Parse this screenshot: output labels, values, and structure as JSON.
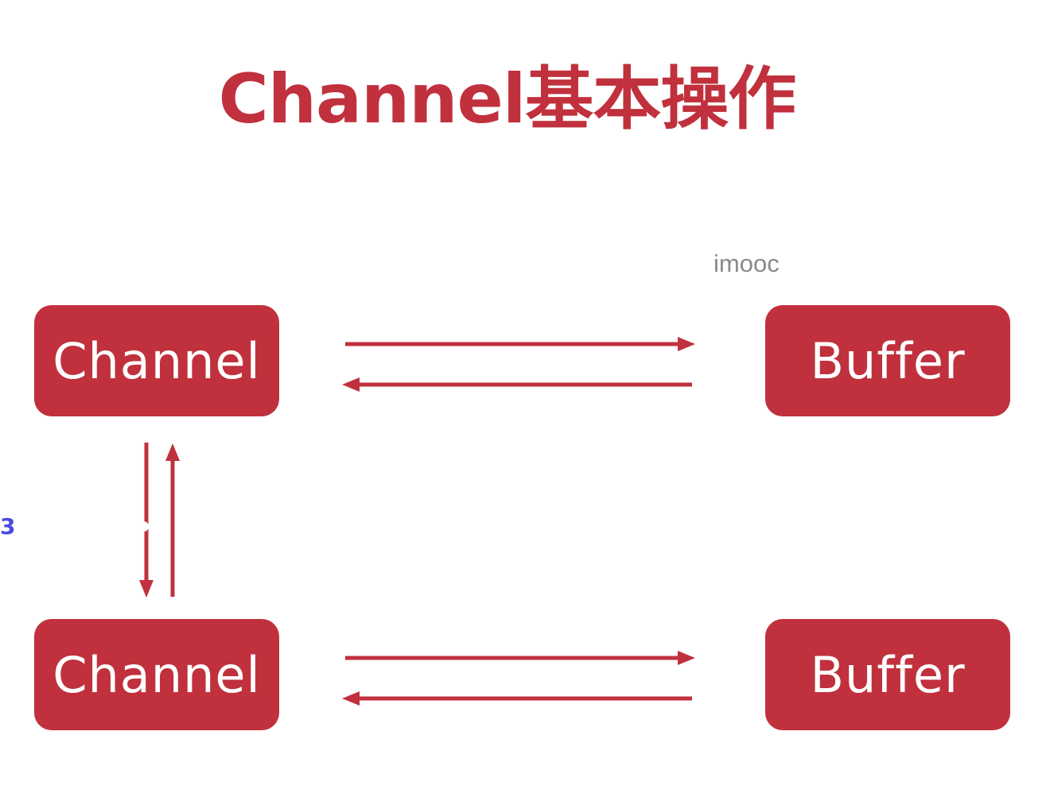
{
  "title": "Channel基本操作",
  "watermark": "imooc",
  "nodes": {
    "channel_top": "Channel",
    "buffer_top": "Buffer",
    "channel_bottom": "Channel",
    "buffer_bottom": "Buffer"
  },
  "edge_label": "3",
  "colors": {
    "accent": "#c0313d",
    "node_text": "#ffffff",
    "watermark": "#8a8a8a",
    "label": "#4a4ae0"
  }
}
